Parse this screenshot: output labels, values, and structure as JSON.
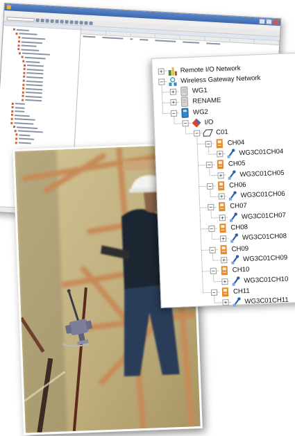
{
  "tree": {
    "nodes": [
      {
        "label": "Remote I/O Network",
        "depth": 0,
        "toggle": "+",
        "icon": "remote-io-network-icon",
        "expanded": false
      },
      {
        "label": "Wireless Gateway Network",
        "depth": 0,
        "toggle": "−",
        "icon": "wireless-network-icon",
        "expanded": true
      },
      {
        "label": "WG1",
        "depth": 1,
        "toggle": "+",
        "icon": "gateway-device-gray-icon",
        "expanded": false
      },
      {
        "label": "RENAME",
        "depth": 1,
        "toggle": "+",
        "icon": "gateway-device-gray-icon",
        "expanded": false
      },
      {
        "label": "WG2",
        "depth": 1,
        "toggle": "−",
        "icon": "gateway-device-blue-icon",
        "expanded": true
      },
      {
        "label": "I/O",
        "depth": 2,
        "toggle": "−",
        "icon": "io-diamond-icon",
        "expanded": true
      },
      {
        "label": "C01",
        "depth": 3,
        "toggle": "−",
        "icon": "card-outline-icon",
        "expanded": true
      },
      {
        "label": "CH04",
        "depth": 4,
        "toggle": "−",
        "icon": "channel-icon",
        "expanded": true
      },
      {
        "label": "WG3C01CH04",
        "depth": 5,
        "toggle": "+",
        "icon": "transmitter-icon",
        "expanded": false
      },
      {
        "label": "CH05",
        "depth": 4,
        "toggle": "−",
        "icon": "channel-icon",
        "expanded": true
      },
      {
        "label": "WG3C01CH05",
        "depth": 5,
        "toggle": "+",
        "icon": "transmitter-icon",
        "expanded": false
      },
      {
        "label": "CH06",
        "depth": 4,
        "toggle": "−",
        "icon": "channel-icon",
        "expanded": true
      },
      {
        "label": "WG3C01CH06",
        "depth": 5,
        "toggle": "+",
        "icon": "transmitter-icon",
        "expanded": false
      },
      {
        "label": "CH07",
        "depth": 4,
        "toggle": "−",
        "icon": "channel-icon",
        "expanded": true
      },
      {
        "label": "WG3C01CH07",
        "depth": 5,
        "toggle": "+",
        "icon": "transmitter-icon",
        "expanded": false
      },
      {
        "label": "CH08",
        "depth": 4,
        "toggle": "−",
        "icon": "channel-icon",
        "expanded": true
      },
      {
        "label": "WG3C01CH08",
        "depth": 5,
        "toggle": "+",
        "icon": "transmitter-icon",
        "expanded": false
      },
      {
        "label": "CH09",
        "depth": 4,
        "toggle": "−",
        "icon": "channel-icon",
        "expanded": true
      },
      {
        "label": "WG3C01CH09",
        "depth": 5,
        "toggle": "+",
        "icon": "transmitter-icon",
        "expanded": false
      },
      {
        "label": "CH10",
        "depth": 4,
        "toggle": "−",
        "icon": "channel-icon",
        "expanded": true
      },
      {
        "label": "WG3C01CH10",
        "depth": 5,
        "toggle": "+",
        "icon": "transmitter-icon",
        "expanded": false
      },
      {
        "label": "CH11",
        "depth": 4,
        "toggle": "−",
        "icon": "channel-icon",
        "expanded": true
      },
      {
        "label": "WG3C01CH11",
        "depth": 5,
        "toggle": "+",
        "icon": "transmitter-icon",
        "expanded": false
      }
    ]
  },
  "colors": {
    "tree_line": "#9a9a9a",
    "channel_orange": "#e58a2c",
    "transmitter_blue": "#2d5ea8",
    "io_red": "#d8432c",
    "gateway_blue": "#2f86c8",
    "wireless_teal": "#2aa0b8"
  }
}
